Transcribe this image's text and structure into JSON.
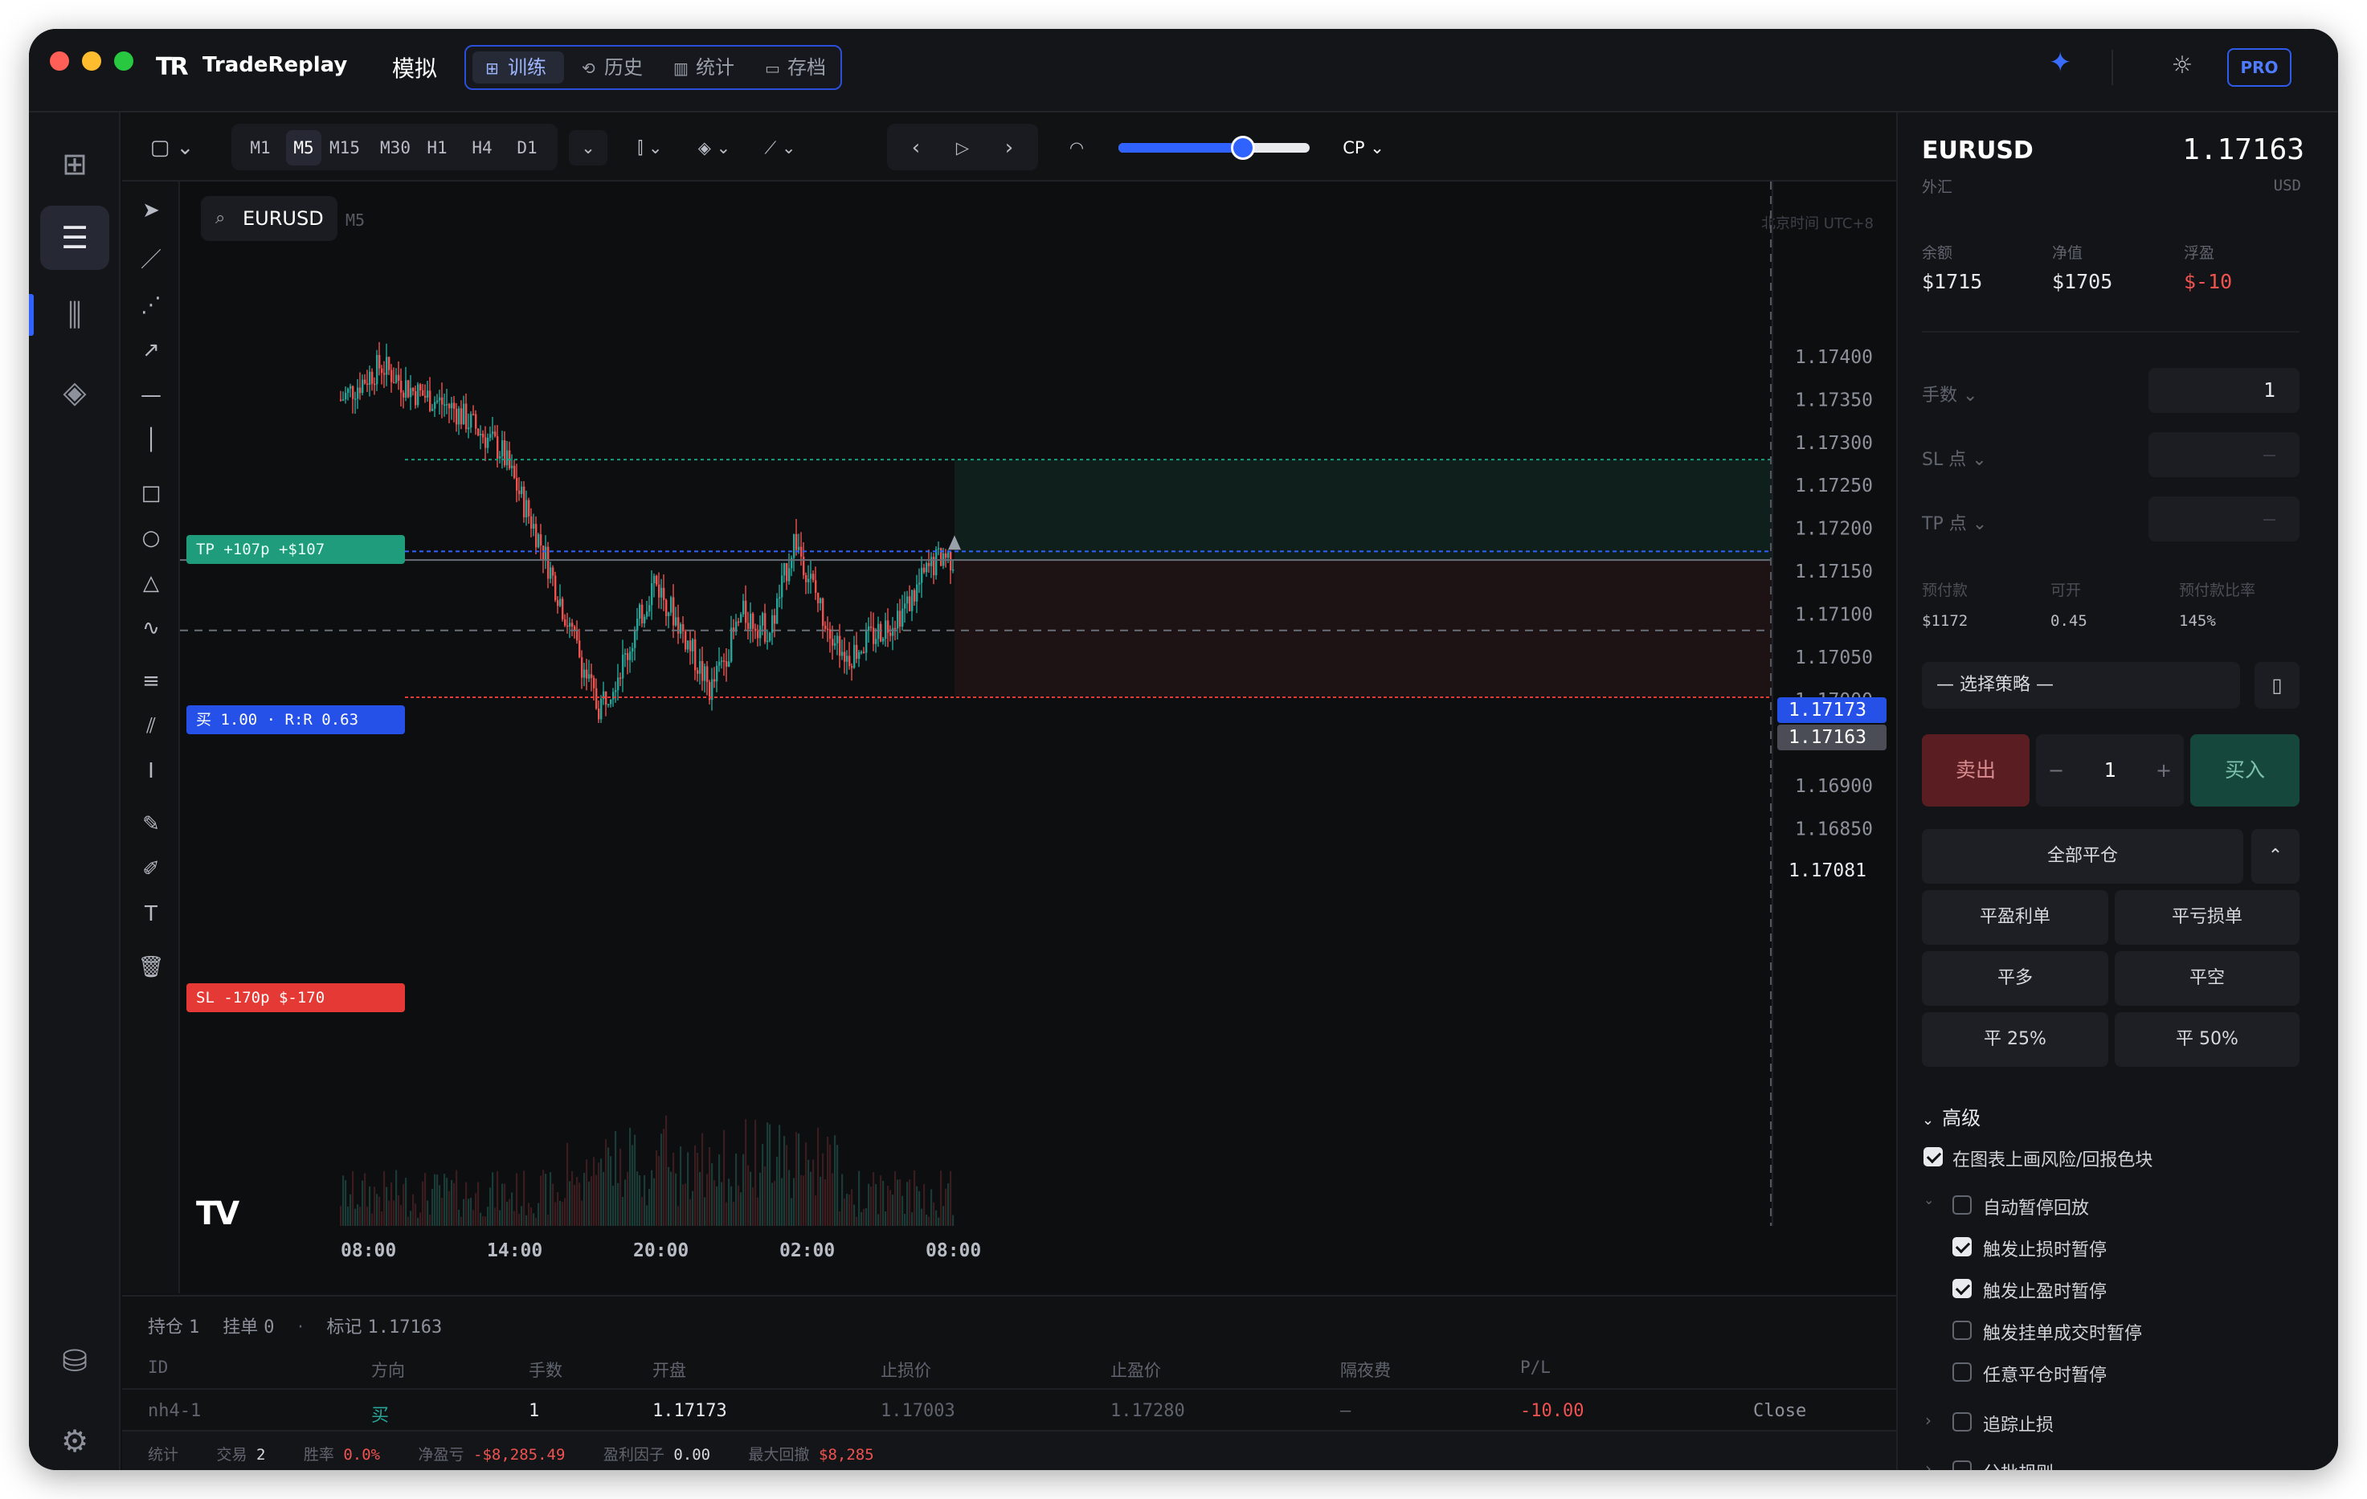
{
  "window": {
    "app_name": "TradeReplay",
    "mode_label": "模拟",
    "pro_label": "PRO"
  },
  "tabs": [
    {
      "label": "训练",
      "icon": "grid-icon"
    },
    {
      "label": "历史",
      "icon": "history-icon"
    },
    {
      "label": "统计",
      "icon": "bar-chart-icon"
    },
    {
      "label": "存档",
      "icon": "archive-icon"
    }
  ],
  "timeframes": [
    "M1",
    "M5",
    "M15",
    "M30",
    "H1",
    "H4",
    "D1"
  ],
  "active_timeframe": "M5",
  "toolbar": {
    "cp_label": "CP",
    "speed_fraction": 0.65
  },
  "chart": {
    "symbol": "EURUSD",
    "timeframe": "M5",
    "timezone_note": "北京时间 UTC+8",
    "price_ticks": [
      "1.17400",
      "1.17350",
      "1.17300",
      "1.17250",
      "1.17200",
      "1.17150",
      "1.17100",
      "1.17050",
      "1.17000",
      "1.16950",
      "1.16900",
      "1.16850"
    ],
    "time_ticks": [
      "08:00",
      "14:00",
      "20:00",
      "02:00",
      "08:00"
    ],
    "tp_label": "TP +107p +$107",
    "entry_label": "买 1.00 · R:R 0.63",
    "sl_label": "SL -170p $-170",
    "entry_price_tag": "1.17173",
    "current_price_tag": "1.17163",
    "crosshair_price_tag": "1.17081",
    "levels": {
      "tp": 1.1728,
      "entry": 1.17173,
      "current": 1.17163,
      "sl": 1.17003,
      "crosshair": 1.17081
    }
  },
  "positions": {
    "tabs": {
      "open_label": "持仓",
      "open_count": "1",
      "pending_label": "挂单",
      "pending_count": "0",
      "mark_label": "标记",
      "mark_value": "1.17163"
    },
    "columns": [
      "ID",
      "方向",
      "手数",
      "开盘",
      "止损价",
      "止盈价",
      "隔夜费",
      "P/L"
    ],
    "rows": [
      {
        "id": "nh4-1",
        "side": "买",
        "lots": "1",
        "open": "1.17173",
        "sl": "1.17003",
        "tp": "1.17280",
        "swap": "—",
        "pl": "-10.00",
        "action": "Close"
      }
    ]
  },
  "stats_bar": {
    "label": "统计",
    "trades_label": "交易",
    "trades": "2",
    "winrate_label": "胜率",
    "winrate": "0.0%",
    "net_label": "净盈亏",
    "net": "-$8,285.49",
    "pf_label": "盈利因子",
    "pf": "0.00",
    "dd_label": "最大回撤",
    "dd": "$8,285"
  },
  "panel": {
    "symbol": "EURUSD",
    "category": "外汇",
    "price": "1.17163",
    "currency": "USD",
    "balance_label": "余额",
    "balance": "$1715",
    "equity_label": "净值",
    "equity": "$1705",
    "float_label": "浮盈",
    "float": "$-10",
    "lots_label": "手数",
    "lots_value": "1",
    "sl_label": "SL 点",
    "sl_value": "—",
    "tp_label": "TP 点",
    "tp_value": "—",
    "margin_label": "预付款",
    "margin": "$1172",
    "available_label": "可开",
    "available": "0.45",
    "ratio_label": "预付款比率",
    "ratio": "145%",
    "strategy_placeholder": "— 选择策略 —",
    "sell_label": "卖出",
    "buy_label": "买入",
    "qty": "1",
    "close_all": "全部平仓",
    "close_profit": "平盈利单",
    "close_loss": "平亏损单",
    "close_long": "平多",
    "close_short": "平空",
    "close_25": "平 25%",
    "close_50": "平 50%",
    "advanced_label": "高级",
    "options": [
      {
        "label": "在图表上画风险/回报色块",
        "checked": true
      },
      {
        "label": "自动暂停回放",
        "checked": false
      },
      {
        "label": "触发止损时暂停",
        "checked": true
      },
      {
        "label": "触发止盈时暂停",
        "checked": true
      },
      {
        "label": "触发挂单成交时暂停",
        "checked": false
      },
      {
        "label": "任意平仓时暂停",
        "checked": false
      },
      {
        "label": "追踪止损",
        "checked": false
      },
      {
        "label": "分批规则",
        "checked": false
      }
    ]
  },
  "colors": {
    "accent": "#2f62ff",
    "up": "#26a69a",
    "down": "#ef5350",
    "sell": "#5a1d22",
    "buy": "#16473d",
    "tp": "#1f9c7c",
    "sl": "#e53935"
  }
}
